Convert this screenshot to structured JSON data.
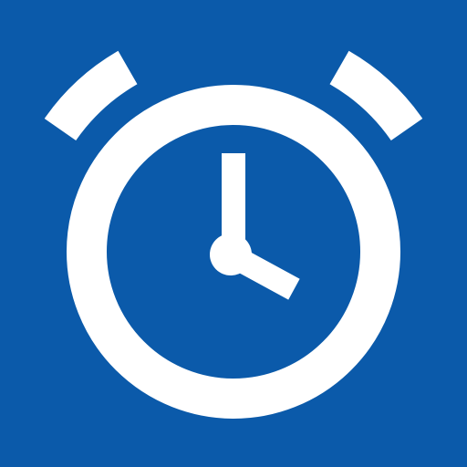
{
  "app_icon": {
    "icon": "alarm-clock-icon",
    "background_color": "#0b5aaa",
    "foreground_color": "#ffffff"
  }
}
